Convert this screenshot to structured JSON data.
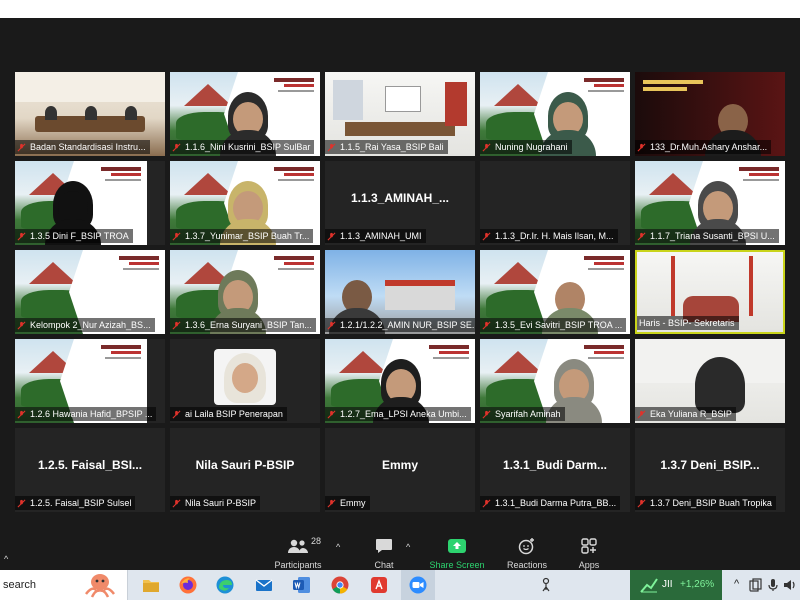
{
  "tiles": [
    {
      "name": "Badan Standardisasi Instru..."
    },
    {
      "name": "1.1.6_Nini Kusrini_BSIP SulBar"
    },
    {
      "name": "1.1.5_Rai Yasa_BSIP Bali"
    },
    {
      "name": "Nuning Nugrahani"
    },
    {
      "name": "133_Dr.Muh.Ashary Anshar..."
    },
    {
      "name": "1.3.5 Dini F_BSIP TROA"
    },
    {
      "name": "1.3.7_Yunimar_BSIP Buah Tr..."
    },
    {
      "name": "1.1.3_AMINAH_UMI",
      "big": "1.1.3_AMINAH_..."
    },
    {
      "name": "1.1.3_Dr.Ir. H. Mais Ilsan, M..."
    },
    {
      "name": "1.1.7_Triana Susanti_BPSI U..."
    },
    {
      "name": "Kelompok 2_Nur Azizah_BS..."
    },
    {
      "name": "1.3.6_Erna Suryani_BSIP Tan..."
    },
    {
      "name": "1.2.1/1.2.2_AMIN NUR_BSIP SE..."
    },
    {
      "name": "1.3.5_Evi Savitri_BSIP TROA ..."
    },
    {
      "name": "Haris - BSIP- Sekretaris"
    },
    {
      "name": "1.2.6 Hawania Hafid_BPSIP ..."
    },
    {
      "name": "ai Laila BSIP Penerapan"
    },
    {
      "name": "1.2.7_Ema_LPSI Aneka Umbi..."
    },
    {
      "name": "Syarifah Aminah"
    },
    {
      "name": "Eka Yuliana R_BSIP"
    },
    {
      "name": "1.2.5. Faisal_BSIP Sulsel",
      "big": "1.2.5. Faisal_BSI..."
    },
    {
      "name": "Nila Sauri P-BSIP",
      "big": "Nila Sauri P-BSIP"
    },
    {
      "name": "Emmy",
      "big": "Emmy"
    },
    {
      "name": "1.3.1_Budi Darma Putra_BB...",
      "big": "1.3.1_Budi Darm..."
    },
    {
      "name": "1.3.7 Deni_BSIP Buah Tropika",
      "big": "1.3.7 Deni_BSIP..."
    }
  ],
  "toolbar": {
    "participants_count": "28",
    "participants_label": "Participants",
    "chat_label": "Chat",
    "share_label": "Share Screen",
    "reactions_label": "Reactions",
    "apps_label": "Apps"
  },
  "taskbar": {
    "search_text": "search",
    "stock_ticker": "JII",
    "stock_change": "+1,26%"
  },
  "colors": {
    "meeting_bg": "#1a1a1a",
    "active_speaker_border": "#c9d41a",
    "share_green": "#2dd36f",
    "mic_muted_red": "#e0322b"
  }
}
